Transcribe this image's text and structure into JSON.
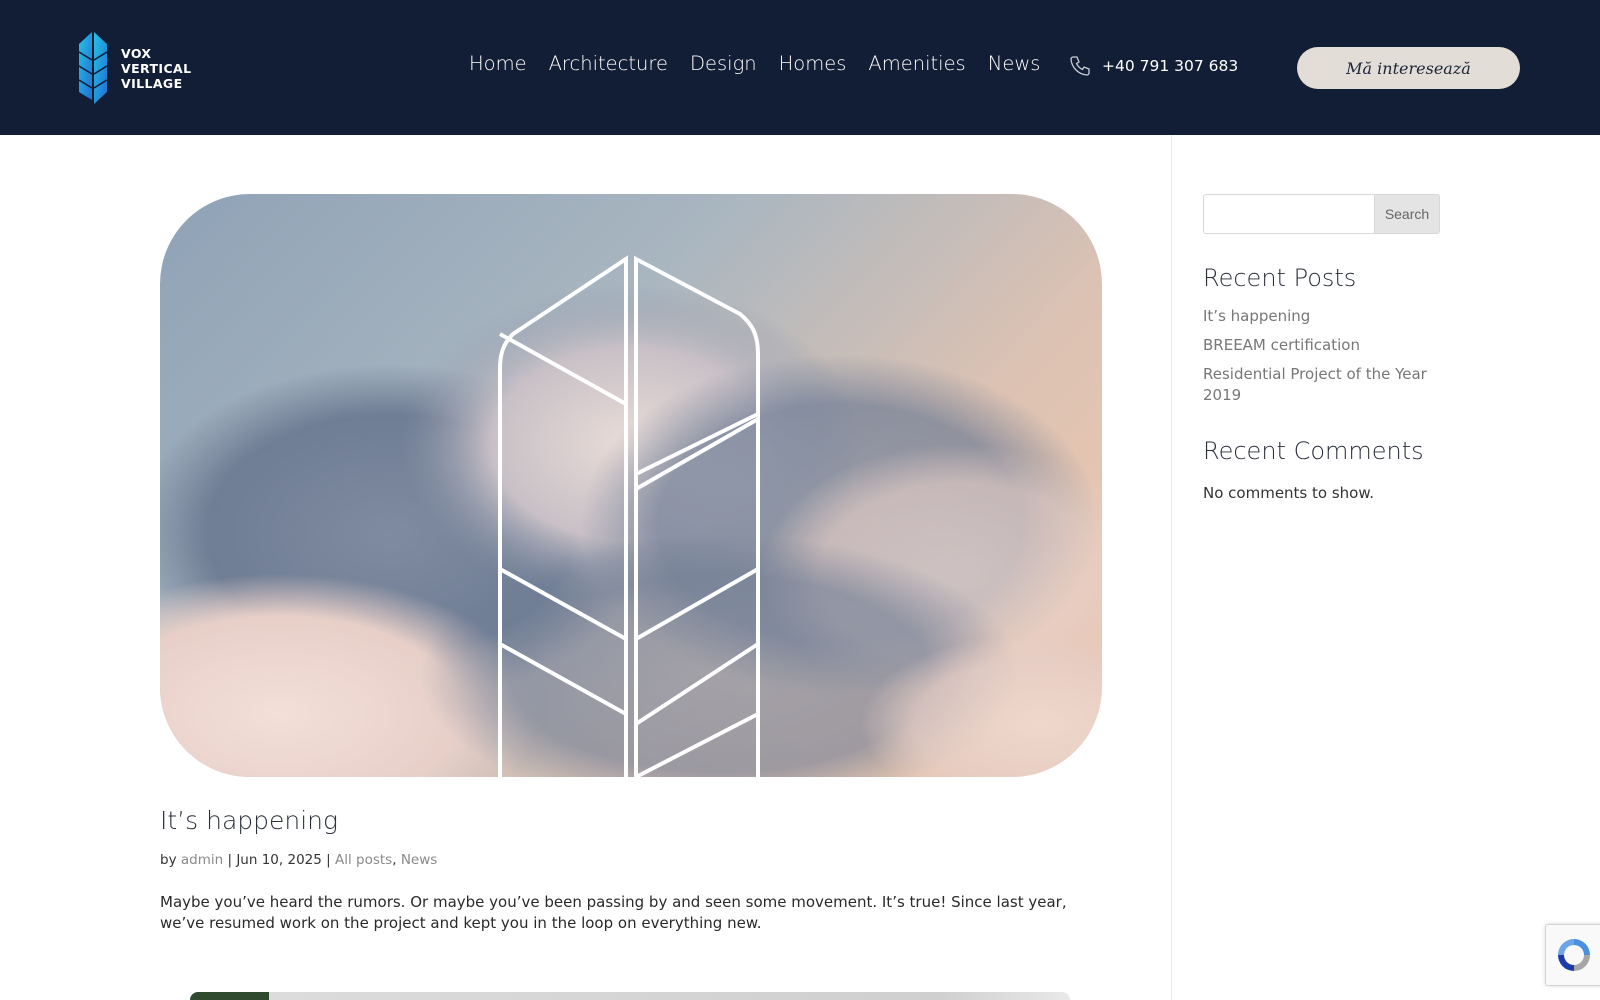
{
  "brand": {
    "logo_lines": [
      "VOX",
      "VERTICAL",
      "VILLAGE"
    ]
  },
  "nav": {
    "items": [
      "Home",
      "Architecture",
      "Design",
      "Homes",
      "Amenities",
      "News"
    ]
  },
  "header": {
    "phone": "+40 791 307 683",
    "cta_label": "Mă interesează"
  },
  "post": {
    "title": "It’s happening",
    "meta": {
      "by": "by",
      "author": "admin",
      "sep1": "|",
      "date": "Jun 10, 2025",
      "sep2": "|",
      "category1": "All posts",
      "comma": ",",
      "category2": "News"
    },
    "excerpt": "Maybe you’ve heard the rumors. Or maybe you’ve been passing by and seen some movement. It’s true! Since last year, we’ve resumed work on the project and kept you in the loop on everything new."
  },
  "sidebar": {
    "search_button": "Search",
    "search_value": "",
    "recent_posts_title": "Recent Posts",
    "recent_posts": [
      "It’s happening",
      "BREEAM certification",
      "Residential Project of the Year 2019"
    ],
    "recent_comments_title": "Recent Comments",
    "no_comments": "No comments to show."
  },
  "colors": {
    "header_bg": "#121d36",
    "cta_bg": "#e3ddd8",
    "link_gray": "#8a8a8a",
    "logo_blue": "#1aa3d9"
  }
}
